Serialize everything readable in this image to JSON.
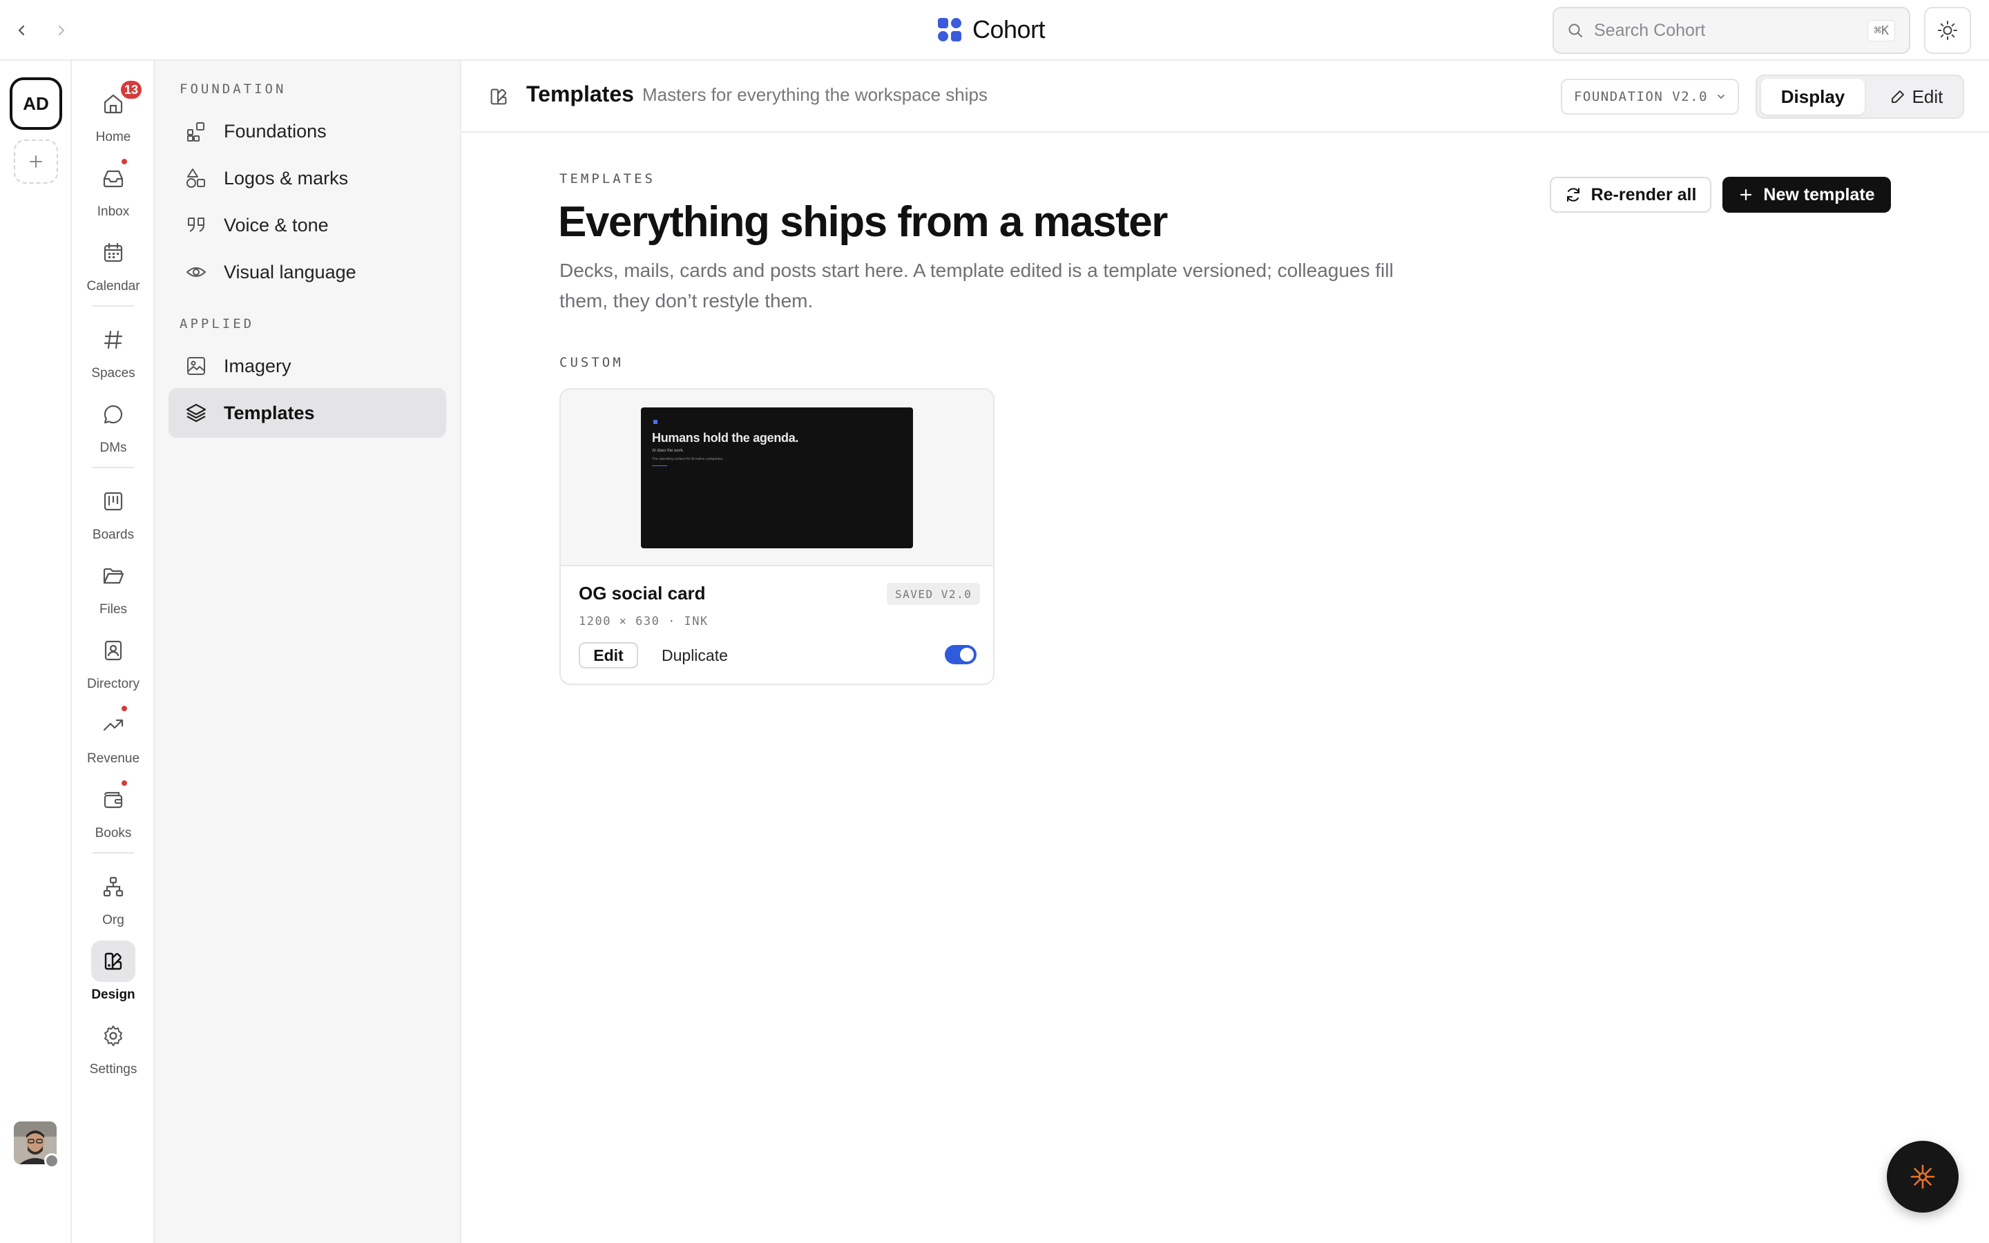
{
  "topbar": {
    "brand_name": "Cohort",
    "search_placeholder": "Search Cohort",
    "search_shortcut": "⌘K"
  },
  "workspace": {
    "initials": "AD"
  },
  "apps": [
    {
      "label": "Home",
      "icon": "home-icon",
      "badge": "13"
    },
    {
      "label": "Inbox",
      "icon": "inbox-icon",
      "dot": true
    },
    {
      "label": "Calendar",
      "icon": "calendar-icon"
    },
    {
      "label": "Spaces",
      "icon": "hash-icon"
    },
    {
      "label": "DMs",
      "icon": "chat-bubble-icon"
    },
    {
      "label": "Boards",
      "icon": "board-icon"
    },
    {
      "label": "Files",
      "icon": "folder-icon"
    },
    {
      "label": "Directory",
      "icon": "contact-icon"
    },
    {
      "label": "Revenue",
      "icon": "trend-up-icon",
      "dot": true
    },
    {
      "label": "Books",
      "icon": "wallet-icon",
      "dot": true
    },
    {
      "label": "Org",
      "icon": "org-chart-icon"
    },
    {
      "label": "Design",
      "icon": "design-icon",
      "active": true
    },
    {
      "label": "Settings",
      "icon": "gear-icon"
    }
  ],
  "section_nav": {
    "groups": [
      {
        "heading": "FOUNDATION",
        "items": [
          {
            "label": "Foundations",
            "icon": "blocks-icon"
          },
          {
            "label": "Logos & marks",
            "icon": "shapes-icon"
          },
          {
            "label": "Voice & tone",
            "icon": "quote-icon"
          },
          {
            "label": "Visual language",
            "icon": "eye-icon"
          }
        ]
      },
      {
        "heading": "APPLIED",
        "items": [
          {
            "label": "Imagery",
            "icon": "image-icon"
          },
          {
            "label": "Templates",
            "icon": "layers-icon",
            "active": true
          }
        ]
      }
    ]
  },
  "page_header": {
    "title": "Templates",
    "subtitle": "Masters for everything the workspace ships",
    "version": "FOUNDATION V2.0",
    "mode_display": "Display",
    "mode_edit": "Edit"
  },
  "main": {
    "eyebrow": "TEMPLATES",
    "headline": "Everything ships from a master",
    "lede": "Decks, mails, cards and posts start here. A template edited is a template versioned; colleagues fill them, they don’t restyle them.",
    "rerender_label": "Re-render all",
    "new_template_label": "New template",
    "custom_label": "CUSTOM",
    "cards": [
      {
        "title": "OG social card",
        "status": "SAVED V2.0",
        "meta": "1200 × 630 · INK",
        "edit_label": "Edit",
        "duplicate_label": "Duplicate",
        "enabled": true,
        "preview_title": "Humans hold the agenda.",
        "preview_line1": "AI does the work.",
        "preview_line2": "The operating surface for AI-native companies."
      }
    ]
  },
  "colors": {
    "accent": "#2f5bdc",
    "badge": "#d63b3b",
    "brand_blue": "#3b5bdb",
    "fab_glyph": "#e8742a"
  }
}
